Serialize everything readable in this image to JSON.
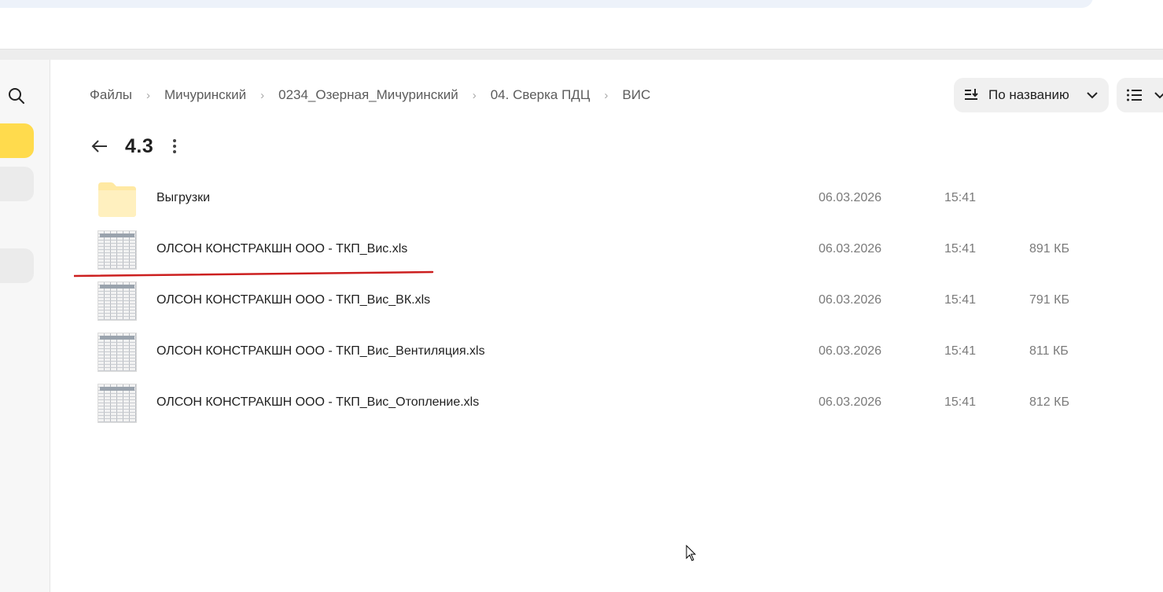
{
  "breadcrumb": {
    "items": [
      "Файлы",
      "Мичуринский",
      "0234_Озерная_Мичуринский",
      "04. Сверка ПДЦ",
      "ВИС"
    ],
    "separator": "›"
  },
  "toolbar": {
    "sort_label": "По названию",
    "sort_icon": "sort-icon",
    "view_icon": "list-view-icon"
  },
  "folder": {
    "title": "4.3"
  },
  "files": [
    {
      "name": "Выгрузки",
      "date": "06.03.2026",
      "time": "15:41",
      "size": "",
      "type": "folder"
    },
    {
      "name": "ОЛСОН КОНСТРАКШН ООО - ТКП_Вис.xls",
      "date": "06.03.2026",
      "time": "15:41",
      "size": "891 КБ",
      "type": "spreadsheet"
    },
    {
      "name": "ОЛСОН КОНСТРАКШН ООО - ТКП_Вис_ВК.xls",
      "date": "06.03.2026",
      "time": "15:41",
      "size": "791 КБ",
      "type": "spreadsheet"
    },
    {
      "name": "ОЛСОН КОНСТРАКШН ООО - ТКП_Вис_Вентиляция.xls",
      "date": "06.03.2026",
      "time": "15:41",
      "size": "811 КБ",
      "type": "spreadsheet"
    },
    {
      "name": "ОЛСОН КОНСТРАКШН ООО - ТКП_Вис_Отопление.xls",
      "date": "06.03.2026",
      "time": "15:41",
      "size": "812 КБ",
      "type": "spreadsheet"
    }
  ],
  "colors": {
    "accent": "#ffdb4d",
    "annotation": "#cc1f1f",
    "folder": "#ffe9a3"
  }
}
